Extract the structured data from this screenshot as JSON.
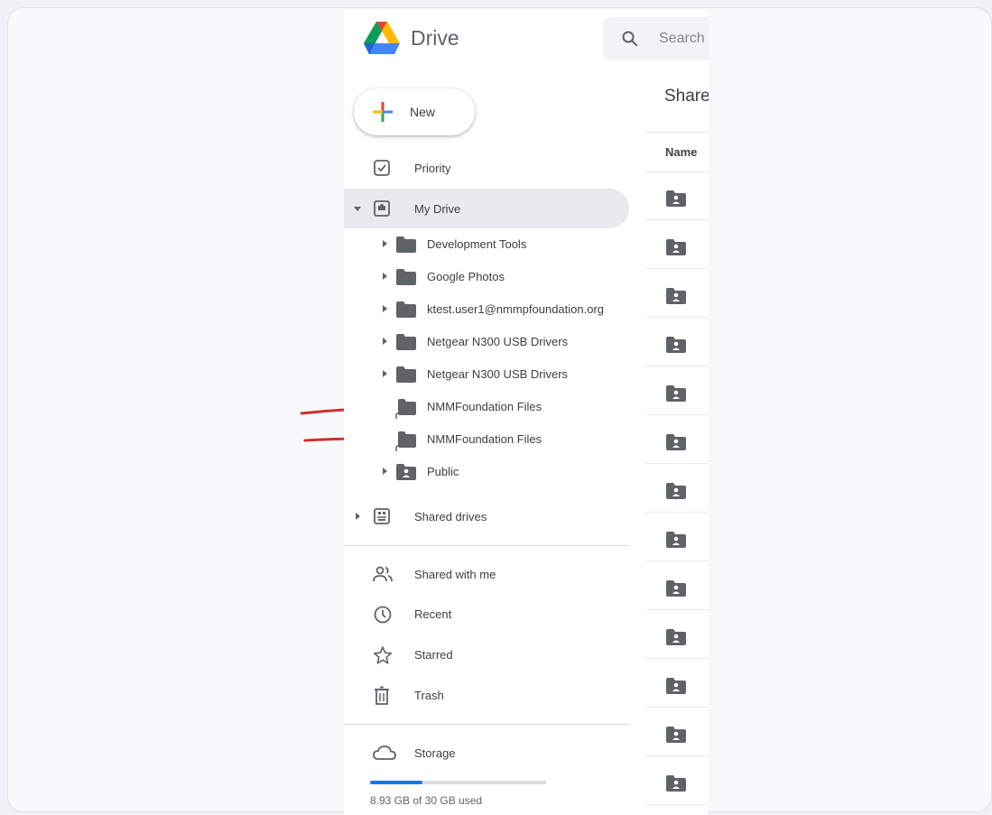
{
  "app": {
    "title": "Drive",
    "search_placeholder": "Search",
    "new_label": "New"
  },
  "nav": {
    "priority": "Priority",
    "my_drive": "My Drive",
    "folders": [
      {
        "label": "Development Tools",
        "type": "folder",
        "expandable": true
      },
      {
        "label": "Google Photos",
        "type": "folder",
        "expandable": true
      },
      {
        "label": "ktest.user1@nmmpfoundation.org",
        "type": "folder",
        "expandable": true
      },
      {
        "label": "Netgear N300 USB Drivers",
        "type": "folder",
        "expandable": true
      },
      {
        "label": "Netgear N300 USB Drivers",
        "type": "folder",
        "expandable": true
      },
      {
        "label": "NMMFoundation Files",
        "type": "shortcut-folder",
        "expandable": false
      },
      {
        "label": "NMMFoundation Files",
        "type": "shortcut-folder",
        "expandable": false
      },
      {
        "label": "Public",
        "type": "shared-folder",
        "expandable": true
      }
    ],
    "shared_drives": "Shared drives",
    "shared_with_me": "Shared with me",
    "recent": "Recent",
    "starred": "Starred",
    "trash": "Trash",
    "storage": "Storage"
  },
  "storage": {
    "used_text": "8.93 GB of 30 GB used",
    "used_fraction": 0.298
  },
  "main": {
    "title": "Share",
    "column_name": "Name",
    "row_count": 13
  },
  "colors": {
    "arrow": "#d32f2f",
    "accent": "#1a73e8",
    "folder": "#5f6368"
  }
}
